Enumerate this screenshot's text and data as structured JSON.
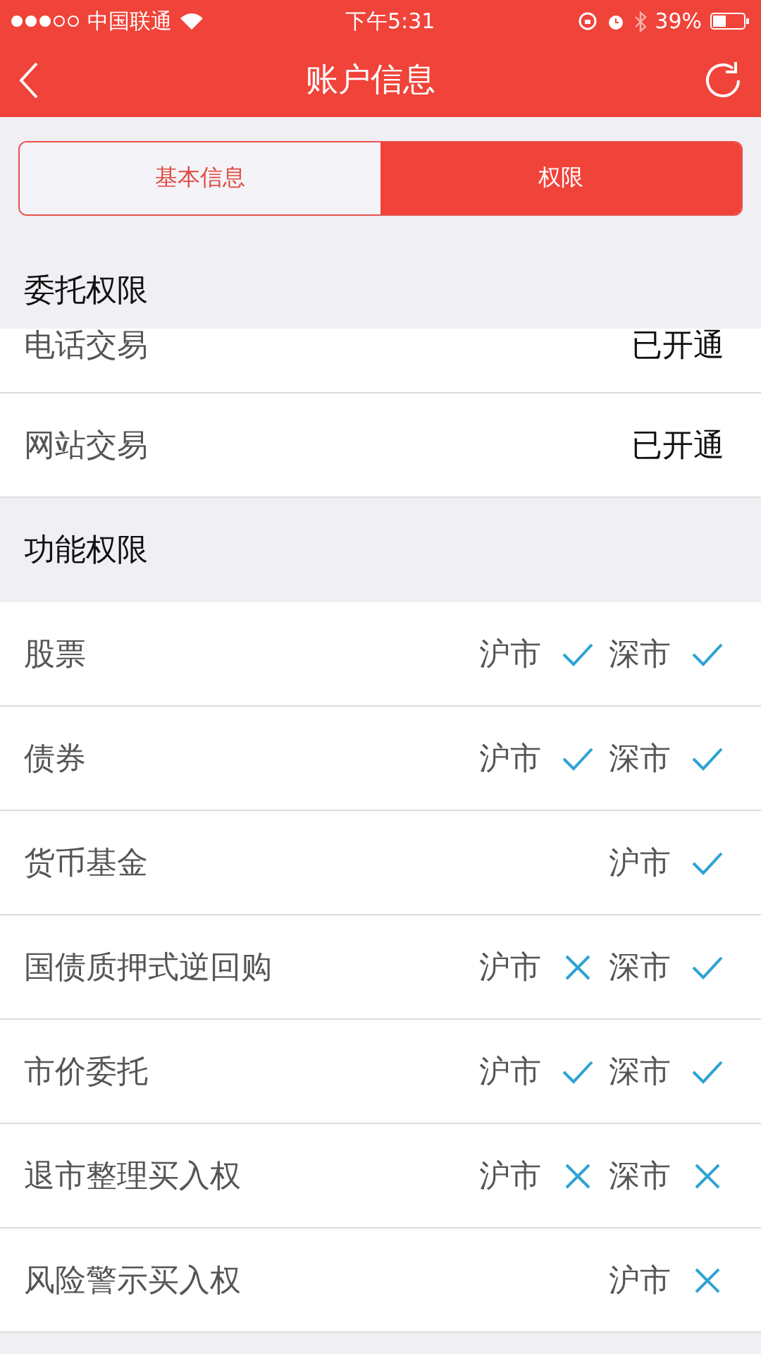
{
  "status_bar": {
    "carrier": "中国联通",
    "time": "下午5:31",
    "battery": "39%"
  },
  "nav": {
    "title": "账户信息"
  },
  "tabs": [
    {
      "label": "基本信息",
      "selected": false
    },
    {
      "label": "权限",
      "selected": true
    }
  ],
  "sections": [
    {
      "title": "委托权限",
      "rows": [
        {
          "kind": "status",
          "label": "电话交易",
          "value": "已开通"
        },
        {
          "kind": "status",
          "label": "网站交易",
          "value": "已开通"
        }
      ]
    },
    {
      "title": "功能权限",
      "rows": [
        {
          "kind": "markets",
          "label": "股票",
          "markets": [
            {
              "name": "沪市",
              "granted": true
            },
            {
              "name": "深市",
              "granted": true
            }
          ]
        },
        {
          "kind": "markets",
          "label": "债券",
          "markets": [
            {
              "name": "沪市",
              "granted": true
            },
            {
              "name": "深市",
              "granted": true
            }
          ]
        },
        {
          "kind": "markets",
          "label": "货币基金",
          "markets": [
            {
              "name": "沪市",
              "granted": true
            }
          ]
        },
        {
          "kind": "markets",
          "label": "国债质押式逆回购",
          "markets": [
            {
              "name": "沪市",
              "granted": false
            },
            {
              "name": "深市",
              "granted": true
            }
          ]
        },
        {
          "kind": "markets",
          "label": "市价委托",
          "markets": [
            {
              "name": "沪市",
              "granted": true
            },
            {
              "name": "深市",
              "granted": true
            }
          ]
        },
        {
          "kind": "markets",
          "label": "退市整理买入权",
          "markets": [
            {
              "name": "沪市",
              "granted": false
            },
            {
              "name": "深市",
              "granted": false
            }
          ]
        },
        {
          "kind": "markets",
          "label": "风险警示买入权",
          "markets": [
            {
              "name": "沪市",
              "granted": false
            }
          ]
        }
      ]
    }
  ]
}
